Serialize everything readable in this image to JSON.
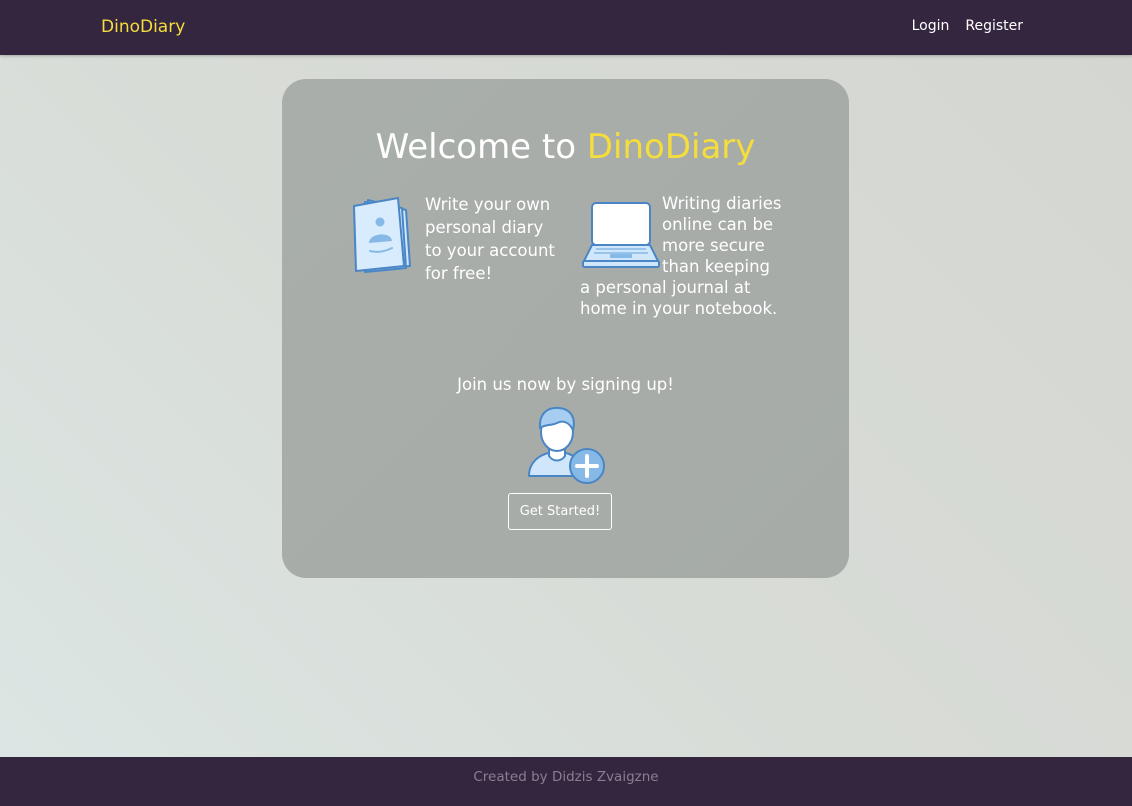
{
  "navbar": {
    "brand": "DinoDiary",
    "links": [
      {
        "label": "Login"
      },
      {
        "label": "Register"
      }
    ]
  },
  "hero": {
    "title_prefix": "Welcome to ",
    "title_accent": "DinoDiary"
  },
  "features": [
    {
      "icon": "diary-book-icon",
      "text": "Write your own personal diary to your account for free!"
    },
    {
      "icon": "laptop-icon",
      "text": "Writing diaries online can be more secure than keeping a personal journal at home in your notebook."
    }
  ],
  "signup": {
    "prompt": "Join us now by signing up!",
    "icon": "add-user-icon",
    "button_label": "Get Started!"
  },
  "footer": {
    "text": "Created by Didzis Zvaigzne"
  },
  "colors": {
    "navbar_bg": "#352640",
    "accent_yellow": "#f5dd3b",
    "card_bg": "#a9aeaa",
    "icon_blue": "#4a86c5",
    "icon_fill": "#cfe6fb"
  }
}
